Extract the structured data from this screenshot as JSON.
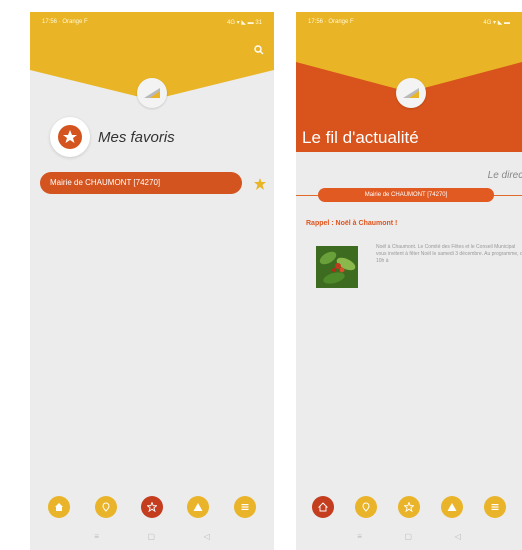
{
  "screen1": {
    "status_left": "17:56 · Orange F",
    "status_right": "4G ▾ ◣ ▬ 31",
    "favorites_title": "Mes favoris",
    "favorite_item": "Mairie de CHAUMONT [74270]"
  },
  "screen2": {
    "status_left": "17:56 · Orange F",
    "status_right": "4G ▾ ◣ ▬",
    "feed_title": "Le fil d'actualité",
    "direct_label": "Le direct",
    "source_label": "Mairie de CHAUMONT [74270]",
    "post_title": "Rappel : Noël à Chaumont !",
    "post_excerpt": "Noël à Chaumont. Le Comité des Fêtes et le Conseil Municipal vous invitent à fêter Noël le samedi 3 décembre. Au programme, de 10h à"
  },
  "system_nav": {
    "recent": "≡",
    "home": "▢",
    "back": "◁"
  },
  "colors": {
    "yellow_header": "#e9b526",
    "orange_header": "#d9541c",
    "pill": "#d3541f",
    "nav_yellow": "#eab42a",
    "nav_active": "#c43d1f"
  },
  "icons": [
    "search-icon",
    "star-icon",
    "home-icon",
    "location-icon",
    "flag-icon",
    "alert-icon",
    "menu-icon"
  ]
}
